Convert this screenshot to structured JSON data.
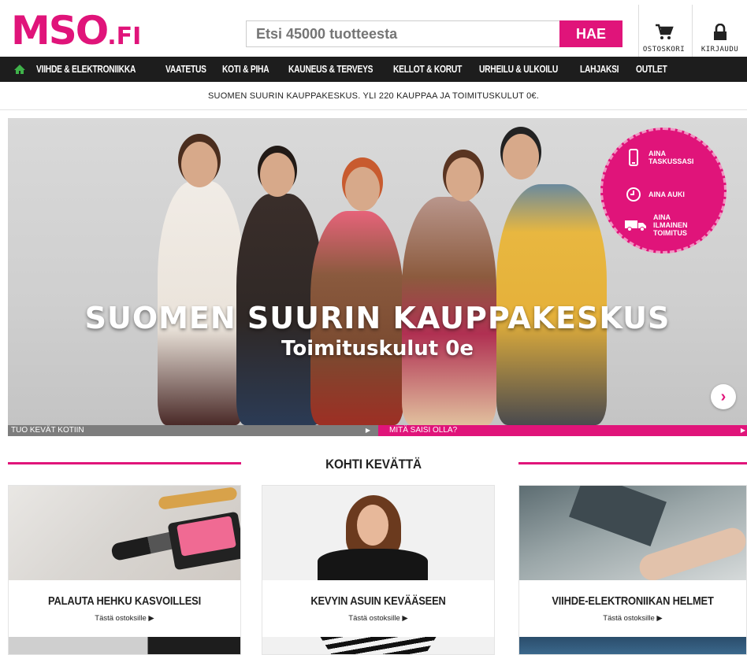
{
  "header": {
    "logo_main": "MSO",
    "logo_suffix": ".FI",
    "search_placeholder": "Etsi 45000 tuotteesta",
    "search_button": "HAE",
    "cart_label": "OSTOSKORI",
    "login_label": "KIRJAUDU"
  },
  "nav": {
    "items": [
      {
        "label": "VIIHDE & ELEKTRONIIKKA"
      },
      {
        "label": "VAATETUS"
      },
      {
        "label": "KOTI & PIHA"
      },
      {
        "label": "KAUNEUS & TERVEYS"
      },
      {
        "label": "KELLOT & KORUT"
      },
      {
        "label": "URHEILU & ULKOILU"
      },
      {
        "label": "LAHJAKSI"
      },
      {
        "label": "OUTLET"
      }
    ]
  },
  "promo_strip": "SUOMEN SUURIN KAUPPAKESKUS. YLI 220 KAUPPAA JA TOIMITUSKULUT 0€.",
  "hero": {
    "title": "SUOMEN SUURIN KAUPPAKESKUS",
    "subtitle": "Toimituskulut 0e",
    "badge": [
      {
        "icon": "phone-icon",
        "text": "AINA TASKUSSASI"
      },
      {
        "icon": "clock-icon",
        "text": "AINA AUKI"
      },
      {
        "icon": "truck-icon",
        "text": "AINA ILMAINEN TOIMITUS"
      }
    ]
  },
  "slider_tabs": [
    {
      "label": "TUO KEVÄT KOTIIN"
    },
    {
      "label": "MITÄ SAISI OLLA?"
    }
  ],
  "section": {
    "title": "KOHTI KEVÄTTÄ"
  },
  "cards": [
    {
      "title": "PALAUTA HEHKU KASVOILLESI",
      "link": "Tästä ostoksille"
    },
    {
      "title": "KEVYIN ASUIN KEVÄÄSEEN",
      "link": "Tästä ostoksille"
    },
    {
      "title": "VIIHDE-ELEKTRONIIKAN HELMET",
      "link": "Tästä ostoksille"
    }
  ],
  "colors": {
    "brand": "#e0147a",
    "nav_bg": "#1d1d1d",
    "home_icon": "#3fb24a"
  }
}
